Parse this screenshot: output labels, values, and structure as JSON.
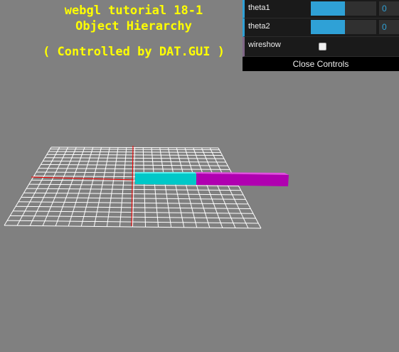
{
  "title": {
    "line1": "webgl tutorial 18-1",
    "line2": "Object Hierarchy",
    "line3": "( Controlled by DAT.GUI )"
  },
  "gui": {
    "controllers": [
      {
        "label": "theta1",
        "value": "0",
        "fraction": 0.52
      },
      {
        "label": "theta2",
        "value": "0",
        "fraction": 0.52
      }
    ],
    "wireshow": {
      "label": "wireshow",
      "checked": false
    },
    "close_label": "Close Controls",
    "colors": {
      "accent": "#2fa1d6",
      "bool_accent": "#806787",
      "bg": "#1a1a1a"
    }
  },
  "scene": {
    "colors": {
      "background": "#808080",
      "grid": "#ffffff",
      "axis_x": "#ff0000",
      "axis_z": "#ff0000",
      "arm1": "#00d0d0",
      "arm2": "#c000c0"
    }
  }
}
